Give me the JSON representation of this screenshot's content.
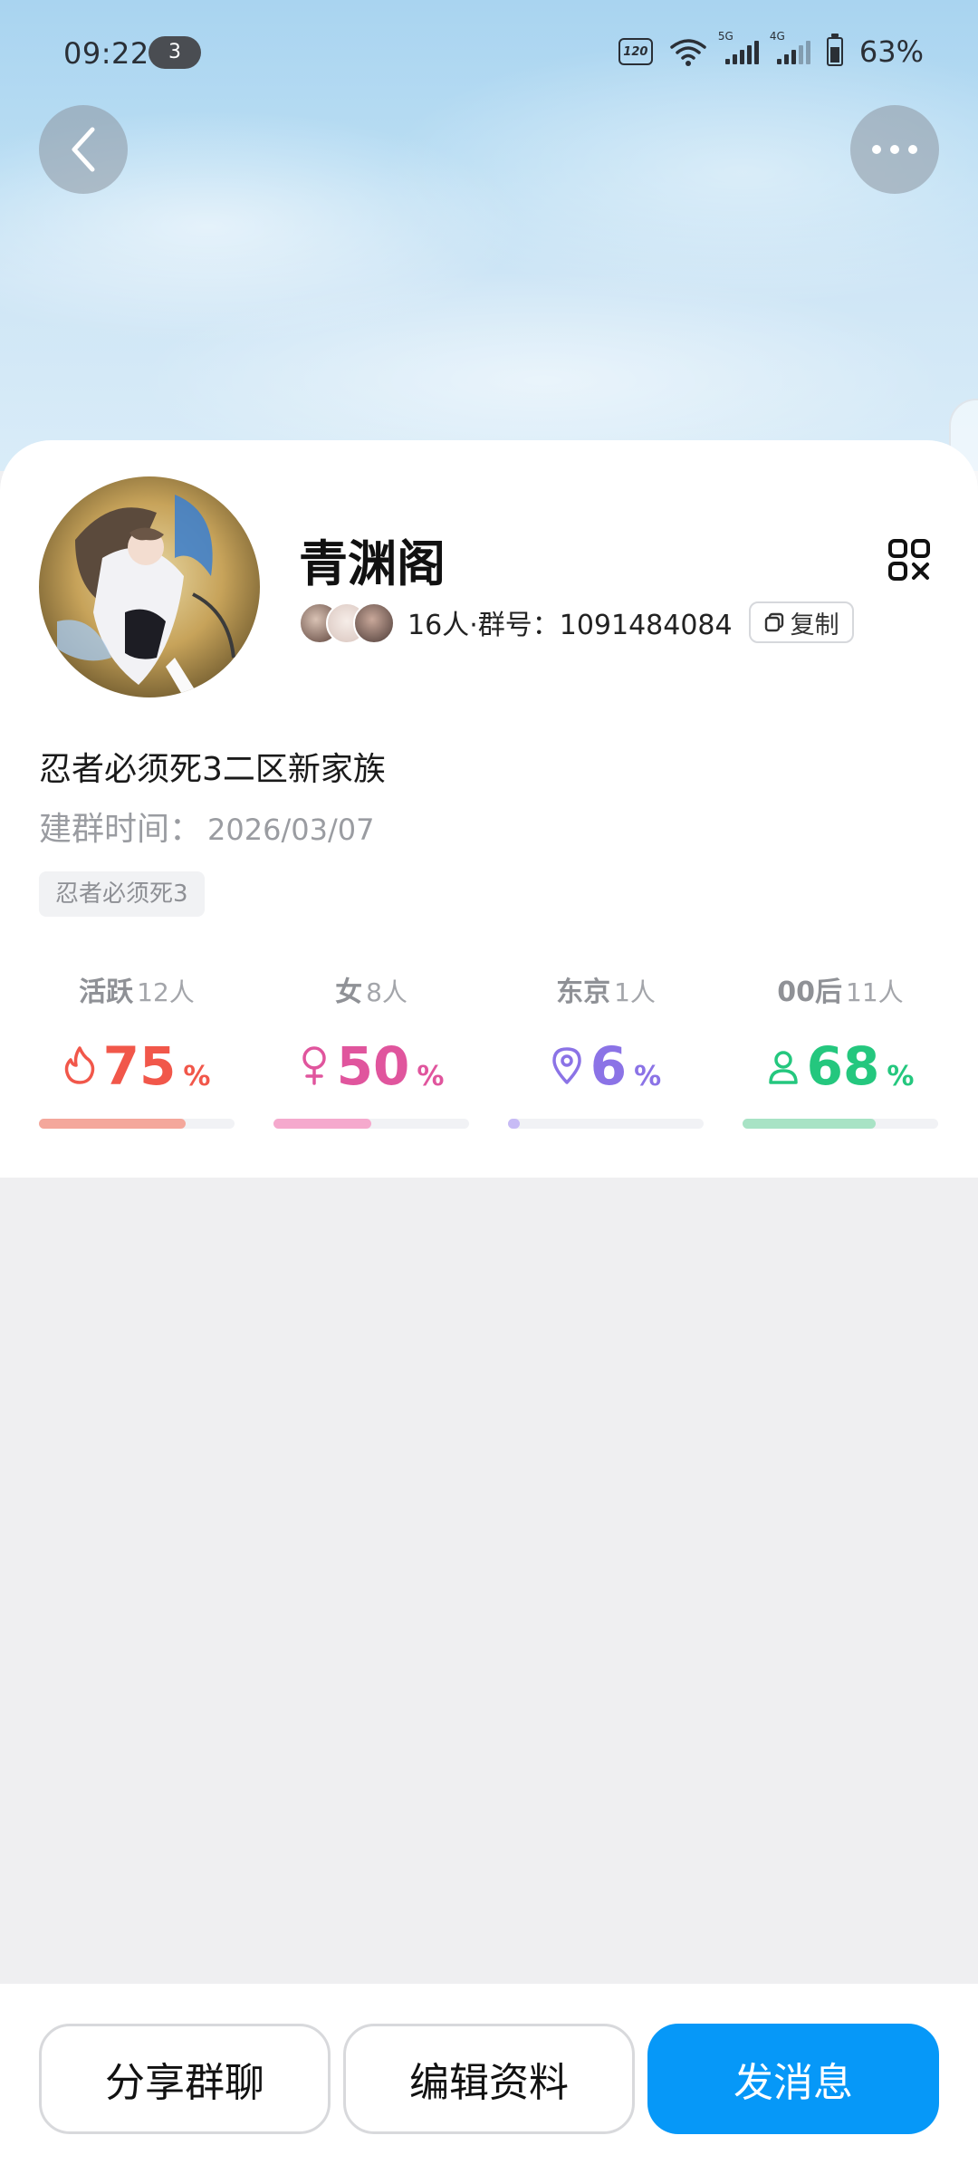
{
  "status_bar": {
    "time": "09:22",
    "notification_count": "3",
    "refresh_rate": "120",
    "network_5g": "5G",
    "network_4g": "4G",
    "battery_pct": "63%"
  },
  "group": {
    "name": "青渊阁",
    "member_count": "16人",
    "separator": "·",
    "id_label": "群号：",
    "id_value": "1091484084",
    "copy_label": "复制",
    "description": "忍者必须死3二区新家族",
    "created_label": "建群时间：",
    "created_date": "2026/03/07",
    "tag": "忍者必须死3"
  },
  "stats": [
    {
      "label": "活跃",
      "count": "12人",
      "percent": "75",
      "unit": "%",
      "icon": "flame-icon",
      "color": "#f1574a",
      "bar_color": "#f4a79b",
      "fill": 0.75
    },
    {
      "label": "女",
      "count": "8人",
      "percent": "50",
      "unit": "%",
      "icon": "female-icon",
      "color": "#e0559d",
      "bar_color": "#f5a9cd",
      "fill": 0.5
    },
    {
      "label": "东京",
      "count": "1人",
      "percent": "6",
      "unit": "%",
      "icon": "location-icon",
      "color": "#8b73e6",
      "bar_color": "#c7bbf5",
      "fill": 0.06
    },
    {
      "label": "00后",
      "count": "11人",
      "percent": "68",
      "unit": "%",
      "icon": "person-icon",
      "color": "#24c77e",
      "bar_color": "#a8e3c5",
      "fill": 0.68
    }
  ],
  "actions": {
    "share": "分享群聊",
    "edit": "编辑资料",
    "message": "发消息"
  },
  "colors": {
    "primary_button": "#0698f8",
    "page_bg": "#efeff1"
  }
}
